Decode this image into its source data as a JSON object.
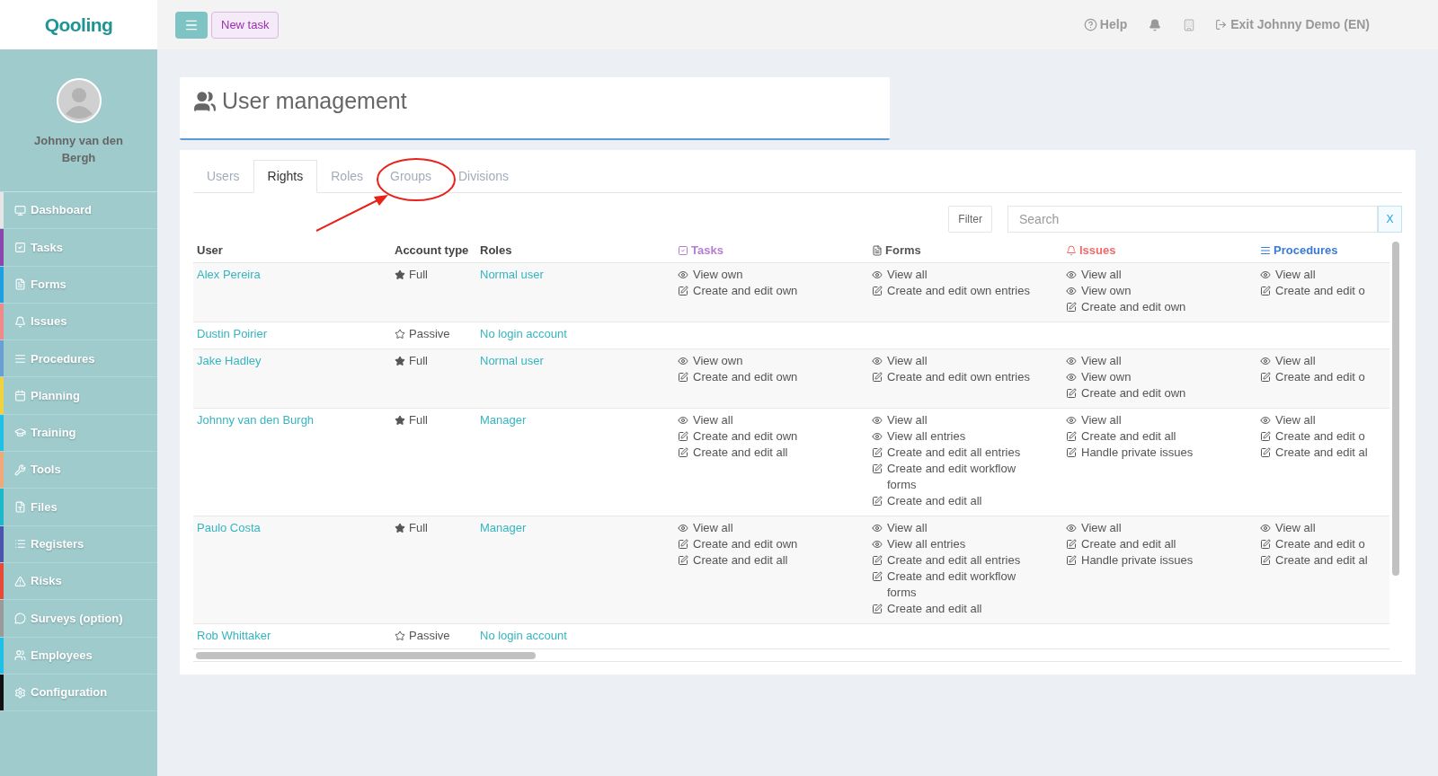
{
  "logo": "Qooling",
  "topbar": {
    "new_task": "New task",
    "help": "Help",
    "exit": "Exit Johnny Demo (EN)"
  },
  "profile": {
    "name": "Johnny van den Bergh"
  },
  "sidebar": {
    "items": [
      {
        "label": "Dashboard",
        "color": "#e6e6e6"
      },
      {
        "label": "Tasks",
        "color": "#8e44ad"
      },
      {
        "label": "Forms",
        "color": "#1ba1e2"
      },
      {
        "label": "Issues",
        "color": "#f08a8a"
      },
      {
        "label": "Procedures",
        "color": "#6a9fd4"
      },
      {
        "label": "Planning",
        "color": "#f0d23c"
      },
      {
        "label": "Training",
        "color": "#1ec0e8"
      },
      {
        "label": "Tools",
        "color": "#f0a878"
      },
      {
        "label": "Files",
        "color": "#1ab8c8"
      },
      {
        "label": "Registers",
        "color": "#4b55b0"
      },
      {
        "label": "Risks",
        "color": "#e84a3a"
      },
      {
        "label": "Surveys (option)",
        "color": "#9a9a9a"
      },
      {
        "label": "Employees",
        "color": "#1ec0e8"
      },
      {
        "label": "Configuration",
        "color": "#111111"
      }
    ]
  },
  "page": {
    "title": "User management"
  },
  "tabs": [
    {
      "label": "Users",
      "selected": false
    },
    {
      "label": "Rights",
      "selected": true
    },
    {
      "label": "Roles",
      "selected": false
    },
    {
      "label": "Groups",
      "selected": false
    },
    {
      "label": "Divisions",
      "selected": false
    }
  ],
  "filter": {
    "button": "Filter",
    "search_placeholder": "Search",
    "clear": "X"
  },
  "table": {
    "columns": [
      {
        "label": "User"
      },
      {
        "label": "Account type"
      },
      {
        "label": "Roles"
      },
      {
        "label": "Tasks",
        "color": "#b57ccf"
      },
      {
        "label": "Forms",
        "color": "#555555"
      },
      {
        "label": "Issues",
        "color": "#f06a6a"
      },
      {
        "label": "Procedures",
        "color": "#3a7bd5"
      }
    ],
    "rows": [
      {
        "user": "Alex Pereira",
        "account": {
          "label": "Full",
          "kind": "full"
        },
        "role": "Normal user",
        "rights": [
          [
            {
              "kind": "view",
              "text": "View own"
            },
            {
              "kind": "edit",
              "text": "Create and edit own"
            }
          ],
          [
            {
              "kind": "view",
              "text": "View all"
            },
            {
              "kind": "edit",
              "text": "Create and edit own entries"
            }
          ],
          [
            {
              "kind": "view",
              "text": "View all"
            },
            {
              "kind": "view",
              "text": "View own"
            },
            {
              "kind": "edit",
              "text": "Create and edit own"
            }
          ],
          [
            {
              "kind": "view",
              "text": "View all"
            },
            {
              "kind": "edit",
              "text": "Create and edit o"
            }
          ]
        ]
      },
      {
        "user": "Dustin Poirier",
        "account": {
          "label": "Passive",
          "kind": "passive"
        },
        "role": "No login account"
      },
      {
        "user": "Jake Hadley",
        "account": {
          "label": "Full",
          "kind": "full"
        },
        "role": "Normal user",
        "rights": [
          [
            {
              "kind": "view",
              "text": "View own"
            },
            {
              "kind": "edit",
              "text": "Create and edit own"
            }
          ],
          [
            {
              "kind": "view",
              "text": "View all"
            },
            {
              "kind": "edit",
              "text": "Create and edit own entries"
            }
          ],
          [
            {
              "kind": "view",
              "text": "View all"
            },
            {
              "kind": "view",
              "text": "View own"
            },
            {
              "kind": "edit",
              "text": "Create and edit own"
            }
          ],
          [
            {
              "kind": "view",
              "text": "View all"
            },
            {
              "kind": "edit",
              "text": "Create and edit o"
            }
          ]
        ]
      },
      {
        "user": "Johnny van den Burgh",
        "account": {
          "label": "Full",
          "kind": "full"
        },
        "role": "Manager",
        "rights": [
          [
            {
              "kind": "view",
              "text": "View all"
            },
            {
              "kind": "edit",
              "text": "Create and edit own"
            },
            {
              "kind": "edit",
              "text": "Create and edit all"
            }
          ],
          [
            {
              "kind": "view",
              "text": "View all"
            },
            {
              "kind": "view",
              "text": "View all entries"
            },
            {
              "kind": "edit",
              "text": "Create and edit all entries"
            },
            {
              "kind": "edit",
              "text": "Create and edit workflow forms"
            },
            {
              "kind": "edit",
              "text": "Create and edit all"
            }
          ],
          [
            {
              "kind": "view",
              "text": "View all"
            },
            {
              "kind": "edit",
              "text": "Create and edit all"
            },
            {
              "kind": "edit",
              "text": "Handle private issues"
            }
          ],
          [
            {
              "kind": "view",
              "text": "View all"
            },
            {
              "kind": "edit",
              "text": "Create and edit o"
            },
            {
              "kind": "edit",
              "text": "Create and edit al"
            }
          ]
        ]
      },
      {
        "user": "Paulo Costa",
        "account": {
          "label": "Full",
          "kind": "full"
        },
        "role": "Manager",
        "rights": [
          [
            {
              "kind": "view",
              "text": "View all"
            },
            {
              "kind": "edit",
              "text": "Create and edit own"
            },
            {
              "kind": "edit",
              "text": "Create and edit all"
            }
          ],
          [
            {
              "kind": "view",
              "text": "View all"
            },
            {
              "kind": "view",
              "text": "View all entries"
            },
            {
              "kind": "edit",
              "text": "Create and edit all entries"
            },
            {
              "kind": "edit",
              "text": "Create and edit workflow forms"
            },
            {
              "kind": "edit",
              "text": "Create and edit all"
            }
          ],
          [
            {
              "kind": "view",
              "text": "View all"
            },
            {
              "kind": "edit",
              "text": "Create and edit all"
            },
            {
              "kind": "edit",
              "text": "Handle private issues"
            }
          ],
          [
            {
              "kind": "view",
              "text": "View all"
            },
            {
              "kind": "edit",
              "text": "Create and edit o"
            },
            {
              "kind": "edit",
              "text": "Create and edit al"
            }
          ]
        ]
      },
      {
        "user": "Rob Whittaker",
        "account": {
          "label": "Passive",
          "kind": "passive"
        },
        "role": "No login account"
      }
    ]
  }
}
